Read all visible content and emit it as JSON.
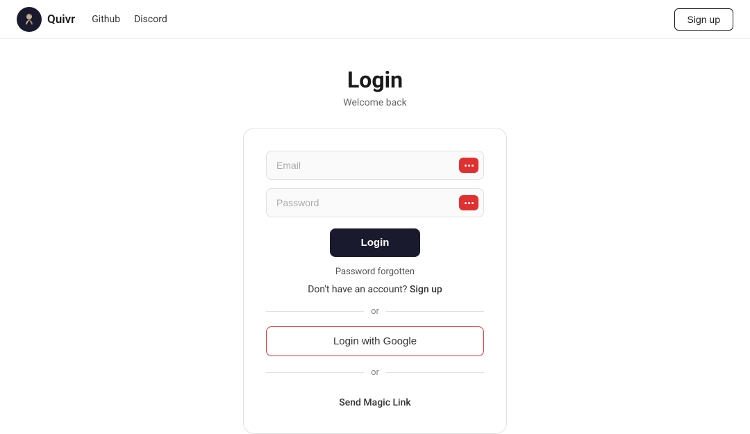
{
  "nav": {
    "brand": "Quivr",
    "links": [
      {
        "label": "Github",
        "name": "github-link"
      },
      {
        "label": "Discord",
        "name": "discord-link"
      }
    ],
    "signup_label": "Sign up"
  },
  "header": {
    "title": "Login",
    "subtitle": "Welcome back"
  },
  "form": {
    "email_placeholder": "Email",
    "password_placeholder": "Password",
    "login_label": "Login",
    "forgot_label": "Password forgotten",
    "signup_prompt": "Don't have an account?",
    "signup_link_label": "Sign up",
    "divider_or": "or",
    "google_label": "Login with Google",
    "magic_link_label": "Send Magic Link"
  }
}
